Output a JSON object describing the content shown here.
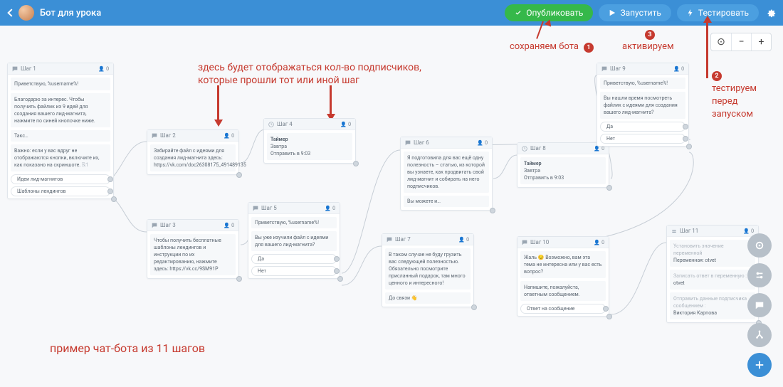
{
  "header": {
    "title": "Бот для урока",
    "publish": "Опубликовать",
    "run": "Запустить",
    "test": "Тестировать"
  },
  "zoom": {
    "reset": "⊙",
    "out": "−",
    "in": "+"
  },
  "annotations": {
    "subscribers": "здесь будет отображаться кол-во подписчиков,\nкоторые прошли тот или иной шаг",
    "save": "сохраняем бота",
    "activate": "активируем",
    "testBefore": "тестируем\nперед\nзапуском",
    "example": "пример чат-бота из 11 шагов",
    "n1": "1",
    "n2": "2",
    "n3": "3"
  },
  "steps": {
    "s1": {
      "title": "Шаг 1",
      "count": "0",
      "b1": "Приветствую, %username%!",
      "b2": "Благодарю за интерес. Чтобы получить файлик из 9 идей для создания вашего лид-магнита, нажмите по синей кнопочке ниже.",
      "b3": "Такс…",
      "b4": "Важно: если у вас вдруг не отображаются кнопки, включите их, как показано на скриншоте.",
      "btn1": "Идеи лид-магнитов",
      "btn2": "Шаблоны лендингов"
    },
    "s2": {
      "title": "Шаг 2",
      "count": "0",
      "b1": "Забирайте файл с идеями для создания лид-магнита здесь: https://vk.com/doc26308175_491489135"
    },
    "s3": {
      "title": "Шаг 3",
      "count": "0",
      "b1": "Чтобы получить бесплатные шаблоны лендингов и инструкции по их редактированию, нажмите здесь: https://vk.cc/9SM91P"
    },
    "s4": {
      "title": "Шаг 4",
      "count": "0",
      "b1t": "Таймер",
      "b1d": "Завтра",
      "b1s": "Отправить в 9:03"
    },
    "s5": {
      "title": "Шаг 5",
      "count": "0",
      "b1": "Приветствую, %username%!",
      "b2": "Вы уже изучили файл с идеями для вашего лид-магнита?",
      "btnYes": "Да",
      "btnNo": "Нет"
    },
    "s6": {
      "title": "Шаг 6",
      "count": "0",
      "b1": "Я подготовила для вас ещё одну полезность – статью, из которой вы узнаете, как продвигать свой лид-магнит и собирать на него подписчиков.",
      "b2": "Вы можете и…"
    },
    "s7": {
      "title": "Шаг 7",
      "count": "0",
      "b1": "В таком случае не буду грузить вас следующей полезностью. Обязательно посмотрите присланный подарок, там много ценного и интересного!",
      "b2": "До связи 👋"
    },
    "s8": {
      "title": "Шаг 8",
      "count": "0",
      "b1t": "Таймер",
      "b1d": "Завтра",
      "b1s": "Отправить в 9:03"
    },
    "s9": {
      "title": "Шаг 9",
      "count": "0",
      "b1": "Приветствую, %username%!",
      "b2": "Вы нашли время посмотреть файлик с идеями для создания вашего лид-магнита?",
      "btnYes": "Да",
      "btnNo": "Нет"
    },
    "s10": {
      "title": "Шаг 10",
      "count": "0",
      "b1": "Жаль 😔\nВозможно, вам эта тема не интересна или у вас есть вопрос?",
      "b2": "Напишите, пожалуйста, ответным сообщением.",
      "btn": "Ответ на сообщение"
    },
    "s11": {
      "title": "Шаг 11",
      "count": "0",
      "l1": "Установить значение переменной",
      "v1": "Переменная: otvet",
      "l2": "Записать ответ в переменную :",
      "v2": "otvet",
      "l3": "Отправить данные подписчика сообщением :",
      "v3": "Виктория Карпова"
    }
  }
}
